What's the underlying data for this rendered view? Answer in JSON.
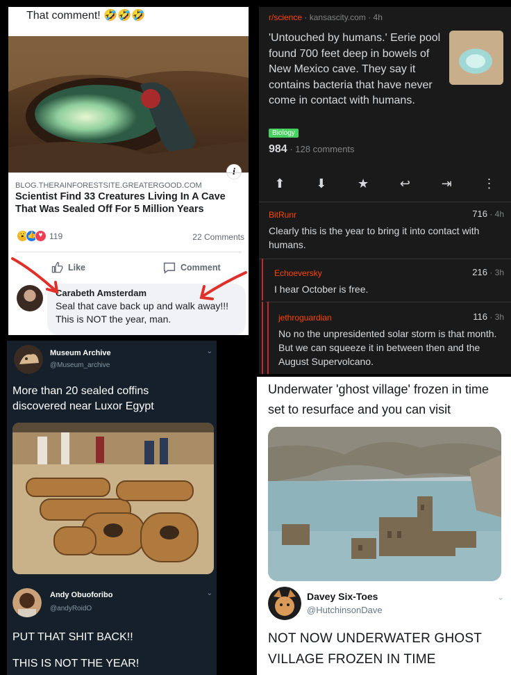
{
  "facebook_post": {
    "caption": "That comment! 🤣🤣🤣",
    "link_source": "BLOG.THERAINFORESTSITE.GREATERGOOD.COM",
    "link_title": "Scientist Find 33 Creatures Living In A Cave That Was Sealed Off For 5 Million Years",
    "reaction_count": "119",
    "comments_count": "22 Comments",
    "like_label": "Like",
    "comment_label": "Comment",
    "comment": {
      "author": "Carabeth Amsterdam",
      "text": "Seal that cave back up and walk away!!! This is NOT the year, man."
    },
    "colors": {
      "like": "#1877f2",
      "love": "#f33e58",
      "haha": "#f7b125",
      "arrow": "#e0302a"
    }
  },
  "reddit_post": {
    "subreddit": "r/science",
    "domain": "kansascity.com",
    "age": "4h",
    "title": "'Untouched by humans.' Eerie pool found 700 feet deep in bowels of New Mexico cave. They say it contains bacteria that have never come in contact with humans.",
    "flair": "Biology",
    "score": "984",
    "comments": "128 comments",
    "actions": [
      "upvote-icon",
      "downvote-icon",
      "star-icon",
      "reply-icon",
      "share-icon",
      "more-icon"
    ],
    "comment_list": [
      {
        "user": "BitRunr",
        "score": "716",
        "age": "4h",
        "body": "Clearly this is the year to bring it into contact with humans."
      },
      {
        "user": "Echoeversky",
        "score": "216",
        "age": "3h",
        "body": "I hear October is free."
      },
      {
        "user": "jethroguardian",
        "score": "116",
        "age": "3h",
        "body": "No no the unpresidented solar storm is that month. But we can squeeze it in between then and the August Supervolcano."
      }
    ],
    "colors": {
      "background": "#1a1a1b",
      "accent": "#ff4500",
      "flair": "#46d160"
    }
  },
  "tweet_dark": {
    "author": {
      "name": "Museum Archive",
      "handle": "@Museum_archive"
    },
    "text": "More than 20 sealed coffins discovered near Luxor Egypt",
    "reply": {
      "name": "Andy Obuoforibo",
      "handle": "@andyRoidO",
      "line1": "PUT THAT SHIT BACK!!",
      "line2": "THIS IS NOT THE YEAR!"
    },
    "colors": {
      "background": "#15202b"
    }
  },
  "tweet_light": {
    "text": "Underwater 'ghost village' frozen in time set to resurface and you can visit",
    "reply": {
      "name": "Davey Six-Toes",
      "handle": "@HutchinsonDave",
      "text": "NOT NOW UNDERWATER GHOST VILLAGE FROZEN IN TIME"
    }
  }
}
